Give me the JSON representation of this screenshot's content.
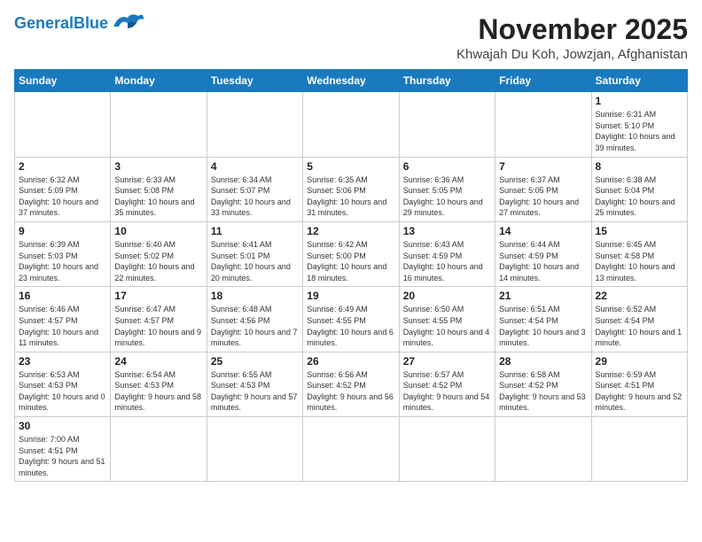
{
  "header": {
    "logo_general": "General",
    "logo_blue": "Blue",
    "month": "November 2025",
    "location": "Khwajah Du Koh, Jowzjan, Afghanistan"
  },
  "days_of_week": [
    "Sunday",
    "Monday",
    "Tuesday",
    "Wednesday",
    "Thursday",
    "Friday",
    "Saturday"
  ],
  "weeks": [
    [
      {
        "day": "",
        "info": ""
      },
      {
        "day": "",
        "info": ""
      },
      {
        "day": "",
        "info": ""
      },
      {
        "day": "",
        "info": ""
      },
      {
        "day": "",
        "info": ""
      },
      {
        "day": "",
        "info": ""
      },
      {
        "day": "1",
        "info": "Sunrise: 6:31 AM\nSunset: 5:10 PM\nDaylight: 10 hours and 39 minutes."
      }
    ],
    [
      {
        "day": "2",
        "info": "Sunrise: 6:32 AM\nSunset: 5:09 PM\nDaylight: 10 hours and 37 minutes."
      },
      {
        "day": "3",
        "info": "Sunrise: 6:33 AM\nSunset: 5:08 PM\nDaylight: 10 hours and 35 minutes."
      },
      {
        "day": "4",
        "info": "Sunrise: 6:34 AM\nSunset: 5:07 PM\nDaylight: 10 hours and 33 minutes."
      },
      {
        "day": "5",
        "info": "Sunrise: 6:35 AM\nSunset: 5:06 PM\nDaylight: 10 hours and 31 minutes."
      },
      {
        "day": "6",
        "info": "Sunrise: 6:36 AM\nSunset: 5:05 PM\nDaylight: 10 hours and 29 minutes."
      },
      {
        "day": "7",
        "info": "Sunrise: 6:37 AM\nSunset: 5:05 PM\nDaylight: 10 hours and 27 minutes."
      },
      {
        "day": "8",
        "info": "Sunrise: 6:38 AM\nSunset: 5:04 PM\nDaylight: 10 hours and 25 minutes."
      }
    ],
    [
      {
        "day": "9",
        "info": "Sunrise: 6:39 AM\nSunset: 5:03 PM\nDaylight: 10 hours and 23 minutes."
      },
      {
        "day": "10",
        "info": "Sunrise: 6:40 AM\nSunset: 5:02 PM\nDaylight: 10 hours and 22 minutes."
      },
      {
        "day": "11",
        "info": "Sunrise: 6:41 AM\nSunset: 5:01 PM\nDaylight: 10 hours and 20 minutes."
      },
      {
        "day": "12",
        "info": "Sunrise: 6:42 AM\nSunset: 5:00 PM\nDaylight: 10 hours and 18 minutes."
      },
      {
        "day": "13",
        "info": "Sunrise: 6:43 AM\nSunset: 4:59 PM\nDaylight: 10 hours and 16 minutes."
      },
      {
        "day": "14",
        "info": "Sunrise: 6:44 AM\nSunset: 4:59 PM\nDaylight: 10 hours and 14 minutes."
      },
      {
        "day": "15",
        "info": "Sunrise: 6:45 AM\nSunset: 4:58 PM\nDaylight: 10 hours and 13 minutes."
      }
    ],
    [
      {
        "day": "16",
        "info": "Sunrise: 6:46 AM\nSunset: 4:57 PM\nDaylight: 10 hours and 11 minutes."
      },
      {
        "day": "17",
        "info": "Sunrise: 6:47 AM\nSunset: 4:57 PM\nDaylight: 10 hours and 9 minutes."
      },
      {
        "day": "18",
        "info": "Sunrise: 6:48 AM\nSunset: 4:56 PM\nDaylight: 10 hours and 7 minutes."
      },
      {
        "day": "19",
        "info": "Sunrise: 6:49 AM\nSunset: 4:55 PM\nDaylight: 10 hours and 6 minutes."
      },
      {
        "day": "20",
        "info": "Sunrise: 6:50 AM\nSunset: 4:55 PM\nDaylight: 10 hours and 4 minutes."
      },
      {
        "day": "21",
        "info": "Sunrise: 6:51 AM\nSunset: 4:54 PM\nDaylight: 10 hours and 3 minutes."
      },
      {
        "day": "22",
        "info": "Sunrise: 6:52 AM\nSunset: 4:54 PM\nDaylight: 10 hours and 1 minute."
      }
    ],
    [
      {
        "day": "23",
        "info": "Sunrise: 6:53 AM\nSunset: 4:53 PM\nDaylight: 10 hours and 0 minutes."
      },
      {
        "day": "24",
        "info": "Sunrise: 6:54 AM\nSunset: 4:53 PM\nDaylight: 9 hours and 58 minutes."
      },
      {
        "day": "25",
        "info": "Sunrise: 6:55 AM\nSunset: 4:53 PM\nDaylight: 9 hours and 57 minutes."
      },
      {
        "day": "26",
        "info": "Sunrise: 6:56 AM\nSunset: 4:52 PM\nDaylight: 9 hours and 56 minutes."
      },
      {
        "day": "27",
        "info": "Sunrise: 6:57 AM\nSunset: 4:52 PM\nDaylight: 9 hours and 54 minutes."
      },
      {
        "day": "28",
        "info": "Sunrise: 6:58 AM\nSunset: 4:52 PM\nDaylight: 9 hours and 53 minutes."
      },
      {
        "day": "29",
        "info": "Sunrise: 6:59 AM\nSunset: 4:51 PM\nDaylight: 9 hours and 52 minutes."
      }
    ],
    [
      {
        "day": "30",
        "info": "Sunrise: 7:00 AM\nSunset: 4:51 PM\nDaylight: 9 hours and 51 minutes."
      },
      {
        "day": "",
        "info": ""
      },
      {
        "day": "",
        "info": ""
      },
      {
        "day": "",
        "info": ""
      },
      {
        "day": "",
        "info": ""
      },
      {
        "day": "",
        "info": ""
      },
      {
        "day": "",
        "info": ""
      }
    ]
  ]
}
